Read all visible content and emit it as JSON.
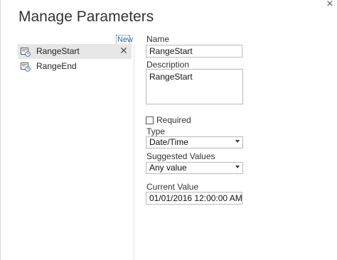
{
  "dialog": {
    "title": "Manage Parameters",
    "close_glyph": "×"
  },
  "list": {
    "new_label": "New",
    "items": [
      {
        "label": "RangeStart",
        "icon": "parameter-icon",
        "selected": true,
        "delete_glyph": "✕"
      },
      {
        "label": "RangeEnd",
        "icon": "parameter-icon",
        "selected": false
      }
    ]
  },
  "form": {
    "name_label": "Name",
    "name_value": "RangeStart",
    "description_label": "Description",
    "description_value": "RangeStart",
    "required_label": "Required",
    "required_checked": false,
    "type_label": "Type",
    "type_value": "Date/Time",
    "suggested_label": "Suggested Values",
    "suggested_value": "Any value",
    "current_label": "Current Value",
    "current_value": "01/01/2016 12:00:00 AM"
  },
  "colors": {
    "selected_bg": "#e6e6e6",
    "link": "#2a63b6",
    "border": "#b9b9b9"
  }
}
